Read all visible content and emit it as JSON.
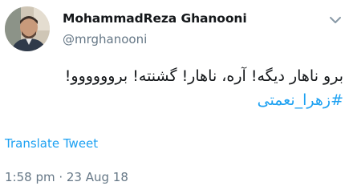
{
  "author": {
    "display_name": "MohammadReza Ghanooni",
    "handle": "@mrghanooni"
  },
  "tweet": {
    "text_line": "برو ناهار دیگه! آره، ناهار! گشنته! بروووووو!",
    "hashtag": "#زهرا_نعمتی"
  },
  "actions": {
    "translate_label": "Translate Tweet",
    "menu_icon": "chevron-down-icon"
  },
  "meta": {
    "timestamp": "1:58 pm · 23 Aug 18"
  },
  "colors": {
    "link": "#1da1f2",
    "secondary_text": "#657786",
    "primary_text": "#14171a"
  }
}
